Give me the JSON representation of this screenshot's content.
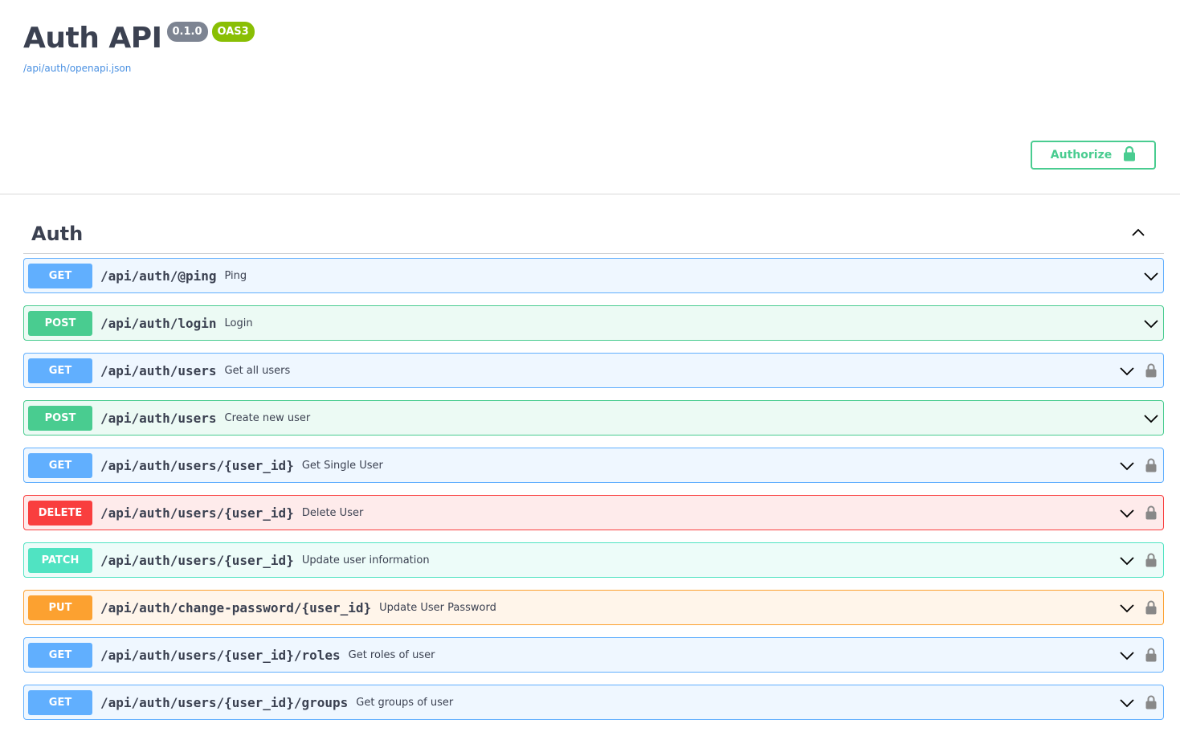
{
  "info": {
    "title": "Auth API",
    "version": "0.1.0",
    "oas_badge": "OAS3",
    "spec_link": "/api/auth/openapi.json"
  },
  "authorize": {
    "label": "Authorize",
    "icon": "lock-icon",
    "color": "#49cc90"
  },
  "tag": {
    "name": "Auth",
    "icon": "chevron-up-icon"
  },
  "method_colors": {
    "GET": "#61affe",
    "POST": "#49cc90",
    "DELETE": "#f93e3e",
    "PATCH": "#50e3c2",
    "PUT": "#fca130"
  },
  "operations": [
    {
      "method": "GET",
      "path": "/api/auth/@ping",
      "summary": "Ping",
      "locked": false
    },
    {
      "method": "POST",
      "path": "/api/auth/login",
      "summary": "Login",
      "locked": false
    },
    {
      "method": "GET",
      "path": "/api/auth/users",
      "summary": "Get all users",
      "locked": true
    },
    {
      "method": "POST",
      "path": "/api/auth/users",
      "summary": "Create new user",
      "locked": false
    },
    {
      "method": "GET",
      "path": "/api/auth/users/{user_id}",
      "summary": "Get Single User",
      "locked": true
    },
    {
      "method": "DELETE",
      "path": "/api/auth/users/{user_id}",
      "summary": "Delete User",
      "locked": true
    },
    {
      "method": "PATCH",
      "path": "/api/auth/users/{user_id}",
      "summary": "Update user information",
      "locked": true
    },
    {
      "method": "PUT",
      "path": "/api/auth/change-password/{user_id}",
      "summary": "Update User Password",
      "locked": true
    },
    {
      "method": "GET",
      "path": "/api/auth/users/{user_id}/roles",
      "summary": "Get roles of user",
      "locked": true
    },
    {
      "method": "GET",
      "path": "/api/auth/users/{user_id}/groups",
      "summary": "Get groups of user",
      "locked": true
    }
  ]
}
